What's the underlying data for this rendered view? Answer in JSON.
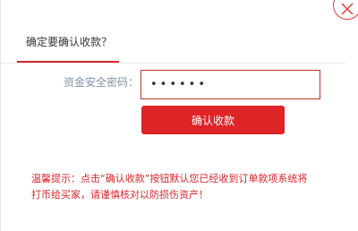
{
  "dialog": {
    "title": "确定要确认收款？",
    "close_icon": "close-icon"
  },
  "form": {
    "password_label": "资金安全密码：",
    "password_value": "••••••",
    "confirm_button": "确认收款"
  },
  "tip": {
    "line1": "温馨提示：点击“确认收款”按钮默认您已经收到订单款项系统将",
    "line2": "打币给买家，请谨慎核对以防损伤资产！"
  },
  "colors": {
    "accent": "#df2426",
    "label": "#7f93a6"
  }
}
